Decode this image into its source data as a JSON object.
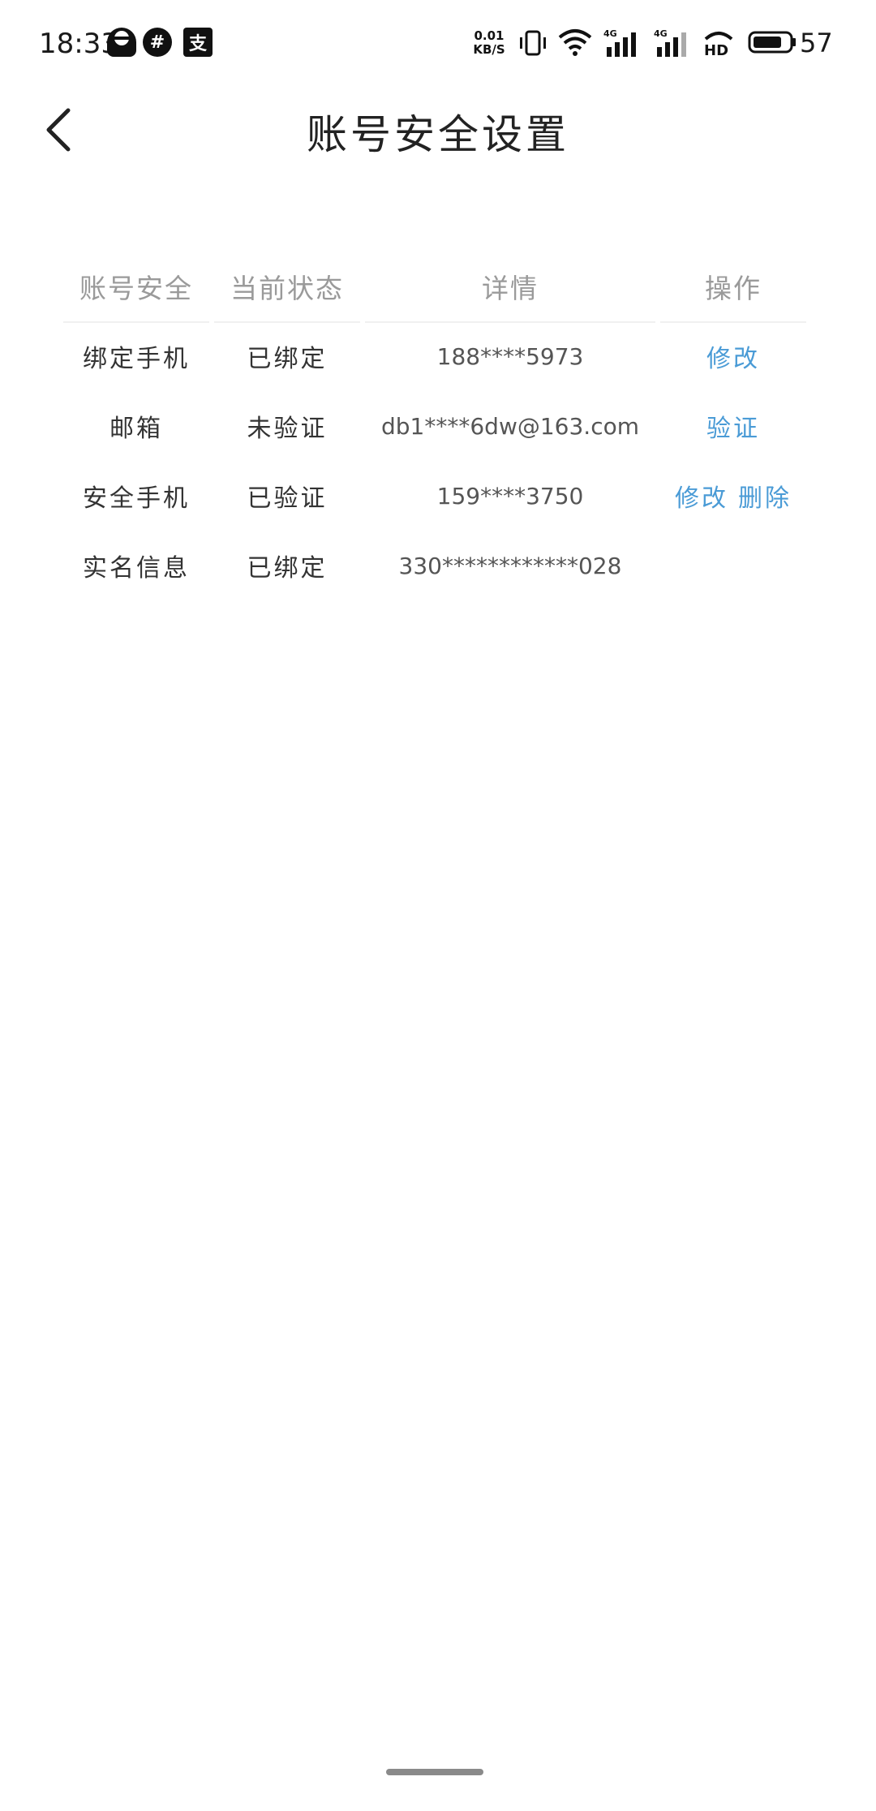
{
  "status_bar": {
    "time": "18:33",
    "net_speed_value": "0.01",
    "net_speed_unit": "KB/S",
    "signal_1_label": "4G",
    "signal_2_label": "4G",
    "hd_label": "HD",
    "battery": "57",
    "icons": [
      "person-notification-icon",
      "hash-notification-icon",
      "alipay-icon",
      "vibrate-icon",
      "wifi-icon",
      "signal-icon",
      "hd-icon",
      "battery-icon"
    ]
  },
  "header": {
    "title": "账号安全设置",
    "back_icon": "chevron-left-icon"
  },
  "table": {
    "columns": [
      "账号安全",
      "当前状态",
      "详情",
      "操作"
    ],
    "rows": [
      {
        "label": "绑定手机",
        "status": "已绑定",
        "detail": "188****5973",
        "actions": [
          "修改"
        ]
      },
      {
        "label": "邮箱",
        "status": "未验证",
        "detail": "db1****6dw@163.com",
        "actions": [
          "验证"
        ]
      },
      {
        "label": "安全手机",
        "status": "已验证",
        "detail": "159****3750",
        "actions": [
          "修改",
          "删除"
        ]
      },
      {
        "label": "实名信息",
        "status": "已绑定",
        "detail": "330************028",
        "actions": []
      }
    ]
  },
  "colors": {
    "link": "#4a9bd6",
    "header_text": "#9a9a9a",
    "body_text": "#333333",
    "background": "#ffffff"
  }
}
